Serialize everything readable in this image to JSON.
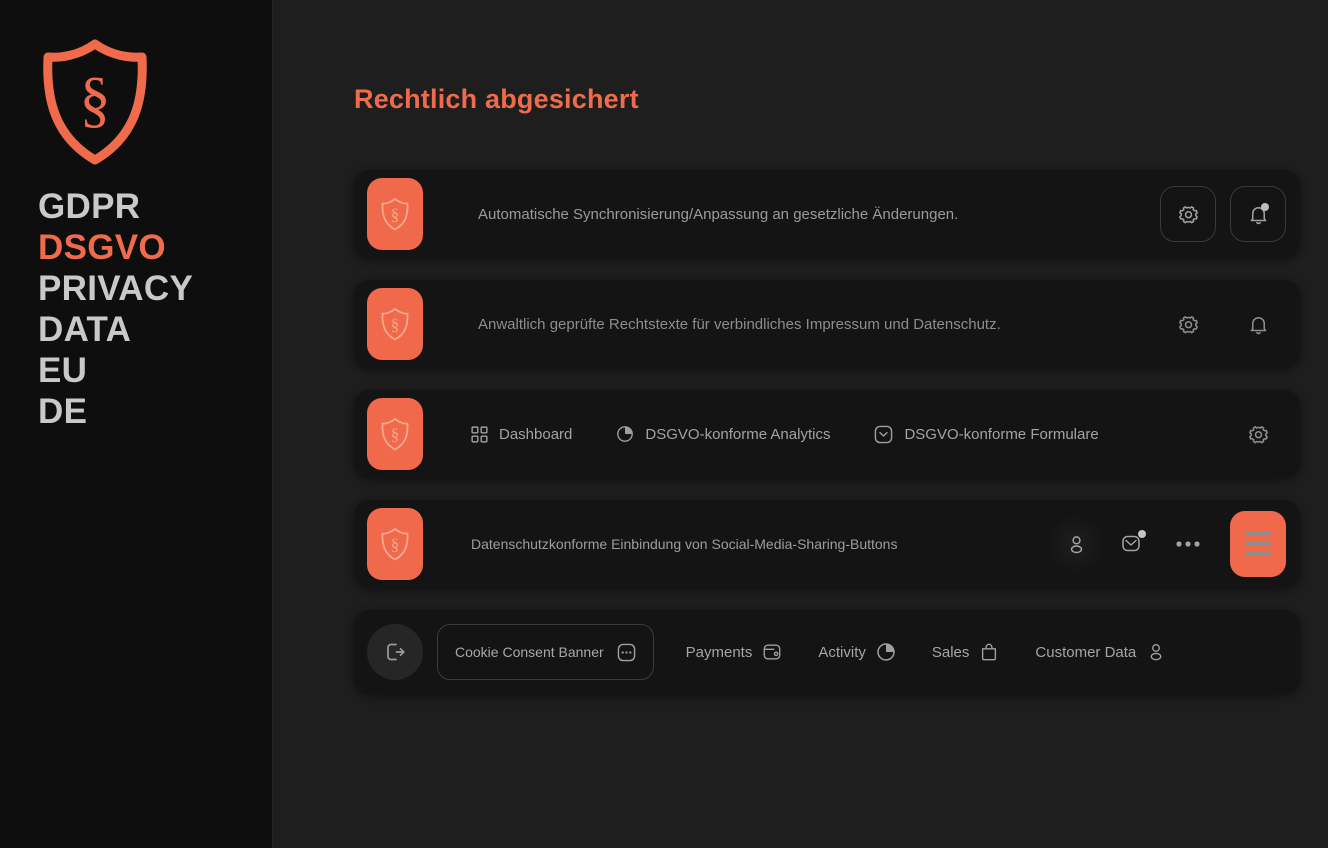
{
  "sidebar": {
    "logo": {
      "icon": "shield-paragraph-logo",
      "color": "#ef6b4b"
    },
    "wordmark": [
      {
        "text": "GDPR",
        "accent": false
      },
      {
        "text": "DSGVO",
        "accent": true
      },
      {
        "text": "PRIVACY",
        "accent": false
      },
      {
        "text": "DATA",
        "accent": false
      },
      {
        "text": "EU",
        "accent": false
      },
      {
        "text": "DE",
        "accent": false
      }
    ]
  },
  "main": {
    "title": "Rechtlich abgesichert",
    "accent_color": "#ef6b4b",
    "rows": [
      {
        "brand_icon": "shield-paragraph-icon",
        "text": "Automatische Synchronisierung/Anpassung an gesetzliche Änderungen.",
        "actions": [
          {
            "icon": "gear-icon",
            "style": "outlined",
            "badge": false
          },
          {
            "icon": "bell-icon",
            "style": "outlined",
            "badge": true
          }
        ]
      },
      {
        "brand_icon": "shield-paragraph-icon",
        "text": "Anwaltlich geprüfte Rechtstexte für verbindliches Impressum und Datenschutz.",
        "actions": [
          {
            "icon": "gear-icon",
            "style": "plain",
            "badge": false
          },
          {
            "icon": "bell-icon",
            "style": "plain",
            "badge": false
          }
        ]
      },
      {
        "brand_icon": "shield-paragraph-icon",
        "nav": [
          {
            "icon": "grid-icon",
            "label": "Dashboard"
          },
          {
            "icon": "pie-chart-icon",
            "label": "DSGVO-konforme Analytics"
          },
          {
            "icon": "chevron-down-square-icon",
            "label": "DSGVO-konforme Formulare"
          }
        ],
        "actions": [
          {
            "icon": "gear-icon",
            "style": "plain",
            "badge": false
          }
        ]
      },
      {
        "brand_icon": "shield-paragraph-icon",
        "text": "Datenschutzkonforme Einbindung von Social-Media-Sharing-Buttons",
        "actions": [
          {
            "icon": "user-icon",
            "style": "plain",
            "badge": false
          },
          {
            "icon": "mail-icon",
            "style": "plain",
            "badge": true
          },
          {
            "icon": "more-horizontal-icon",
            "style": "plain",
            "badge": false
          },
          {
            "icon": "hamburger-menu-icon",
            "style": "coral",
            "badge": false
          }
        ]
      }
    ],
    "bottom_bar": {
      "logout_icon": "logout-icon",
      "pill": {
        "label": "Cookie Consent Banner",
        "icon": "dots-square-icon"
      },
      "links": [
        {
          "label": "Payments",
          "icon": "wallet-icon"
        },
        {
          "label": "Activity",
          "icon": "pie-chart-icon"
        },
        {
          "label": "Sales",
          "icon": "shopping-bag-icon"
        },
        {
          "label": "Customer Data",
          "icon": "user-icon"
        }
      ]
    }
  }
}
